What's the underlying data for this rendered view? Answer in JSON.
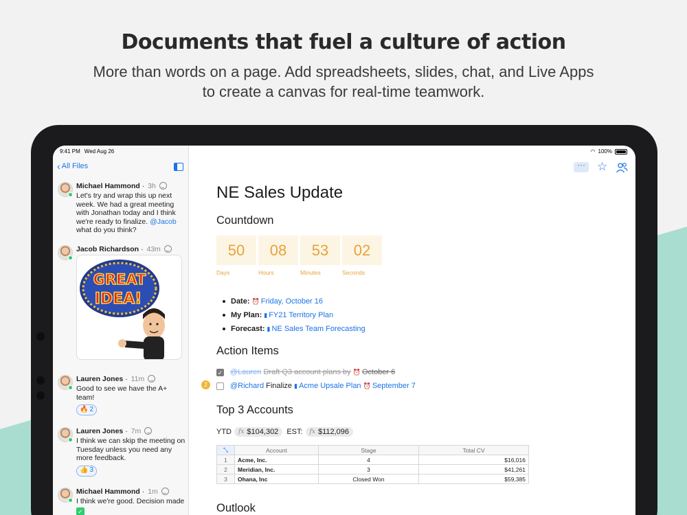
{
  "marketing": {
    "headline": "Documents that fuel a culture of action",
    "subhead": "More than words on a page. Add spreadsheets, slides, chat, and Live Apps to create a canvas for real-time teamwork."
  },
  "colors": {
    "accent": "#1a73e8",
    "countdown": "#e8a23a",
    "teal": "#a9ddd0",
    "online": "#2ecc71"
  },
  "status": {
    "time": "9:41 PM",
    "date": "Wed Aug 26",
    "battery": "100%"
  },
  "sidebar": {
    "back_label": "All Files",
    "messages": [
      {
        "name": "Michael Hammond",
        "time": "3h",
        "text": "Let's try and wrap this up next week. We had a great meeting with Jonathan today and I think we're ready to finalize.",
        "mention": "@Jacob",
        "text_after": "what do you think?"
      },
      {
        "name": "Jacob Richardson",
        "time": "43m",
        "sticker": "GREAT IDEA!"
      },
      {
        "name": "Lauren Jones",
        "time": "11m",
        "text": "Good to see we have the A+ team!",
        "reaction_emoji": "🔥",
        "reaction_count": "2"
      },
      {
        "name": "Lauren Jones",
        "time": "7m",
        "text": "I think we can skip the meeting on Tuesday unless you need any more feedback.",
        "reaction_emoji": "👍",
        "reaction_count": "3"
      },
      {
        "name": "Michael Hammond",
        "time": "1m",
        "text": "I think we're good. Decision made"
      }
    ]
  },
  "doc": {
    "title": "NE Sales Update",
    "countdown_heading": "Countdown",
    "countdown": [
      {
        "value": "50",
        "label": "Days"
      },
      {
        "value": "08",
        "label": "Hours"
      },
      {
        "value": "53",
        "label": "Minutes"
      },
      {
        "value": "02",
        "label": "Seconds"
      }
    ],
    "bullets": {
      "date_label": "Date:",
      "date_value": "Friday, October 16",
      "plan_label": "My Plan:",
      "plan_value": "FY21 Territory Plan",
      "forecast_label": "Forecast:",
      "forecast_value": "NE Sales Team Forecasting"
    },
    "action_heading": "Action Items",
    "actions": [
      {
        "mention": "@Lauren",
        "text": "Draft Q3 account plans by",
        "date": "October 6",
        "done": true
      },
      {
        "mention": "@Richard",
        "text": "Finalize",
        "doc": "Acme Upsale Plan",
        "date": "September 7",
        "done": false,
        "comments": "2"
      }
    ],
    "accounts_heading": "Top 3 Accounts",
    "ytd_label": "YTD",
    "ytd_value": "$104,302",
    "est_label": "EST:",
    "est_value": "$112,096",
    "fx_glyph": "fx",
    "sheet": {
      "headers": [
        "Account",
        "Stage",
        "Total CV"
      ],
      "rows": [
        {
          "n": "1",
          "account": "Acme, Inc.",
          "stage": "4",
          "cv": "$16,016"
        },
        {
          "n": "2",
          "account": "Meridian, Inc.",
          "stage": "3",
          "cv": "$41,261"
        },
        {
          "n": "3",
          "account": "Ohana, Inc",
          "stage": "Closed Won",
          "cv": "$59,385"
        }
      ]
    },
    "outlook_heading": "Outlook"
  }
}
